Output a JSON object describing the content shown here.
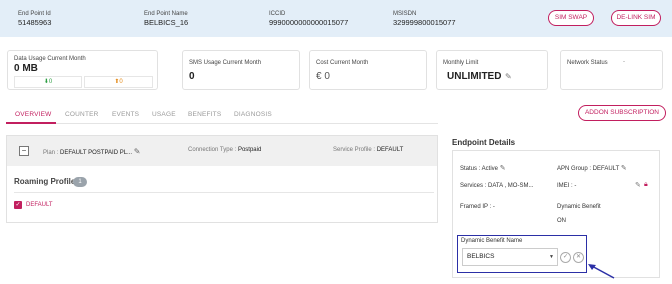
{
  "header": {
    "endpoint_id_label": "End Point Id",
    "endpoint_id": "51485963",
    "endpoint_name_label": "End Point Name",
    "endpoint_name": "BELBICS_16",
    "iccid_label": "ICCID",
    "iccid": "9990000000000015077",
    "msisdn_label": "MSISDN",
    "msisdn": "329999800015077",
    "sim_swap_label": "SIM SWAP",
    "delink_sim_label": "DE-LINK SIM"
  },
  "metrics": {
    "data_usage_label": "Data Usage Current Month",
    "data_usage_value": "0 MB",
    "download": "0",
    "upload": "0",
    "sms_label": "SMS Usage Current Month",
    "sms_value": "0",
    "cost_label": "Cost Current Month",
    "cost_value": "€ 0",
    "limit_label": "Monthly Limit",
    "limit_value": "UNLIMITED",
    "network_label": "Network Status",
    "network_value": "-"
  },
  "tabs": [
    "OVERVIEW",
    "COUNTER",
    "EVENTS",
    "USAGE",
    "BENEFITS",
    "DIAGNOSIS"
  ],
  "addon_label": "ADDON SUBSCRIPTION",
  "overview": {
    "plan_label": "Plan :",
    "plan_value": "DEFAULT POSTPAID PL...",
    "connection_label": "Connection Type :",
    "connection_value": "Postpaid",
    "service_label": "Service Profile :",
    "service_value": "DEFAULT",
    "roaming_title": "Roaming Profile",
    "roaming_count": "1",
    "roaming_item": "DEFAULT"
  },
  "endpoint": {
    "title": "Endpoint Details",
    "status": "Status : Active",
    "apn": "APN Group : DEFAULT",
    "services": "Services : DATA , MO-SM...",
    "imei": "IMEI : -",
    "framed_ip": "Framed IP : -",
    "dynamic_benefit_label": "Dynamic Benefit",
    "dynamic_benefit_value": "ON",
    "db_name_label": "Dynamic Benefit Name",
    "db_name_value": "BELBICS"
  },
  "colors": {
    "accent": "#c21f5f",
    "header_bg": "#e3eef8",
    "highlight": "#2b2fa6"
  }
}
